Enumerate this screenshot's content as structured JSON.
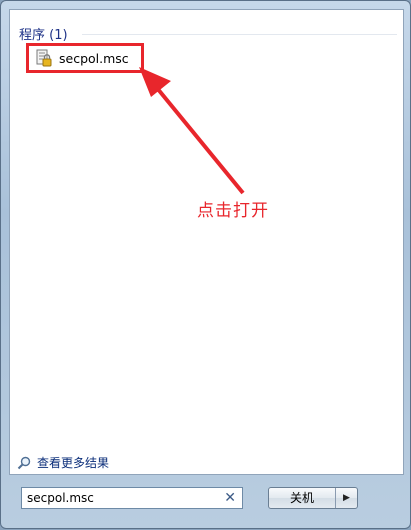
{
  "results": {
    "section_title": "程序 (1)",
    "items": [
      {
        "label": "secpol.msc",
        "icon": "security-policy-icon"
      }
    ]
  },
  "annotation": {
    "text": "点击打开",
    "color": "#e8262c"
  },
  "see_more": {
    "label": "查看更多结果",
    "icon": "search-icon"
  },
  "search": {
    "value": "secpol.msc",
    "clear_icon": "clear-icon"
  },
  "shutdown": {
    "label": "关机",
    "menu_icon": "arrow-right-icon"
  }
}
